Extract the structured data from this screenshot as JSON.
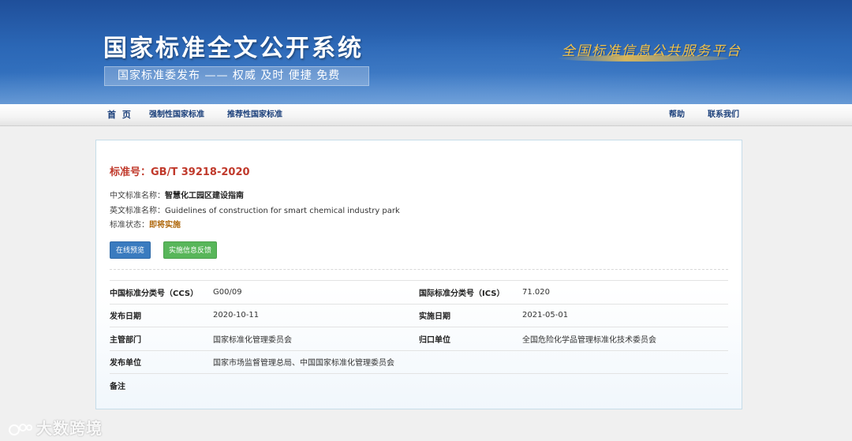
{
  "header": {
    "site_title": "国家标准全文公开系统",
    "slogan": "国家标准委发布 —— 权威  及时  便捷  免费",
    "platform_slogan": "全国标准信息公共服务平台"
  },
  "nav": {
    "home": "首 页",
    "mandatory": "强制性国家标准",
    "recommended": "推荐性国家标准",
    "help": "帮助",
    "contact": "联系我们"
  },
  "standard": {
    "number_label": "标准号：",
    "number": "GB/T 39218-2020",
    "cn_name_label": "中文标准名称：",
    "cn_name": "智慧化工园区建设指南",
    "en_name_label": "英文标准名称：",
    "en_name": "Guidelines of construction for smart chemical industry park",
    "status_label": "标准状态：",
    "status": "即将实施"
  },
  "buttons": {
    "preview": "在线预览",
    "feedback": "实施信息反馈"
  },
  "details": {
    "ccs_label": "中国标准分类号（CCS）",
    "ccs": "G00/09",
    "ics_label": "国际标准分类号（ICS）",
    "ics": "71.020",
    "publish_date_label": "发布日期",
    "publish_date": "2020-10-11",
    "implement_date_label": "实施日期",
    "implement_date": "2021-05-01",
    "authority_label": "主管部门",
    "authority": "国家标准化管理委员会",
    "responsible_label": "归口单位",
    "responsible": "全国危险化学品管理标准化技术委员会",
    "publisher_label": "发布单位",
    "publisher": "国家市场监督管理总局、中国国家标准化管理委员会",
    "remarks_label": "备注",
    "remarks": ""
  },
  "watermark": {
    "text": "大数跨境"
  }
}
